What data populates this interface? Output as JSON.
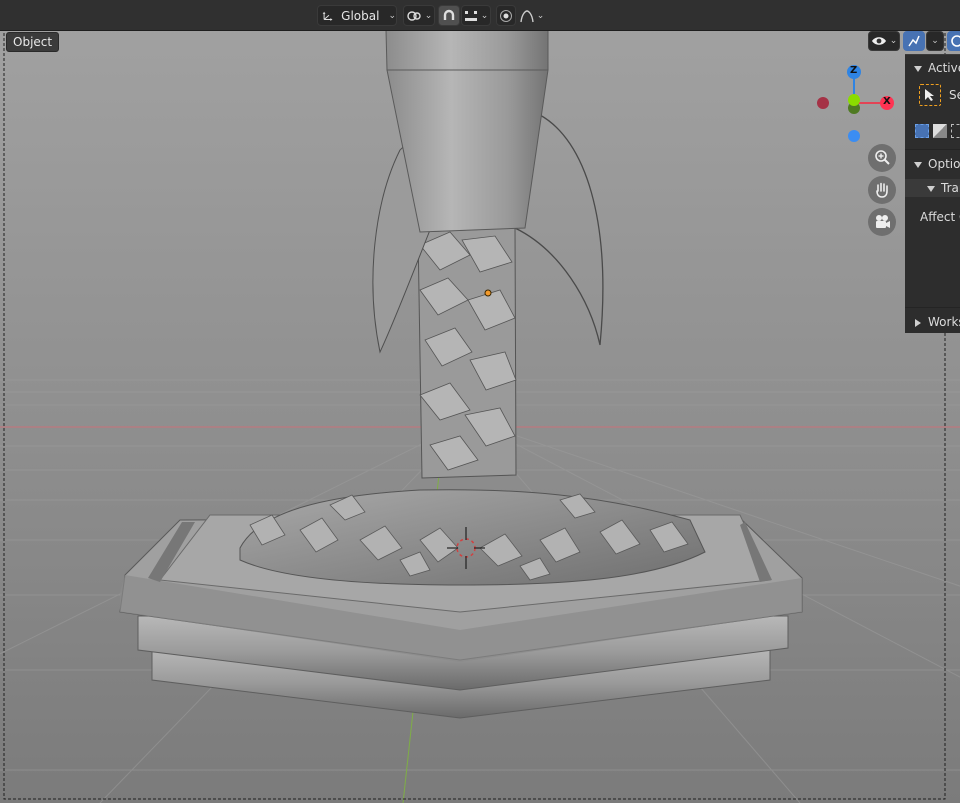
{
  "header": {
    "orientation": {
      "label": "Global",
      "icon": "transform-orientation-icon"
    },
    "pivot_icon": "pivot-point-icon",
    "snap_icon": "snap-magnet-icon",
    "snap_target_icon": "snap-increment-icon",
    "proportional_icons": [
      "proportional-edit-icon",
      "falloff-curve-icon"
    ],
    "right_icons": [
      "visibility-eye-icon",
      "gizmo-icon",
      "overlay-icon"
    ]
  },
  "viewport": {
    "mode_label": "Object",
    "gizmo": {
      "z": "Z",
      "x": "X",
      "colors": {
        "x": "#ff3352",
        "y": "#8bdc00",
        "z": "#2f84e3",
        "neg_x": "#a53246",
        "neg_z": "#3b8df2"
      }
    },
    "nav_icons": [
      "zoom-icon",
      "hand-pan-icon",
      "camera-icon"
    ]
  },
  "side_panel": {
    "active_tool_header": "Active",
    "tool_label": "Se",
    "options_header": "Option",
    "transform_header": "Tran",
    "affect_label": "Affect O",
    "workspace_header": "Works"
  }
}
